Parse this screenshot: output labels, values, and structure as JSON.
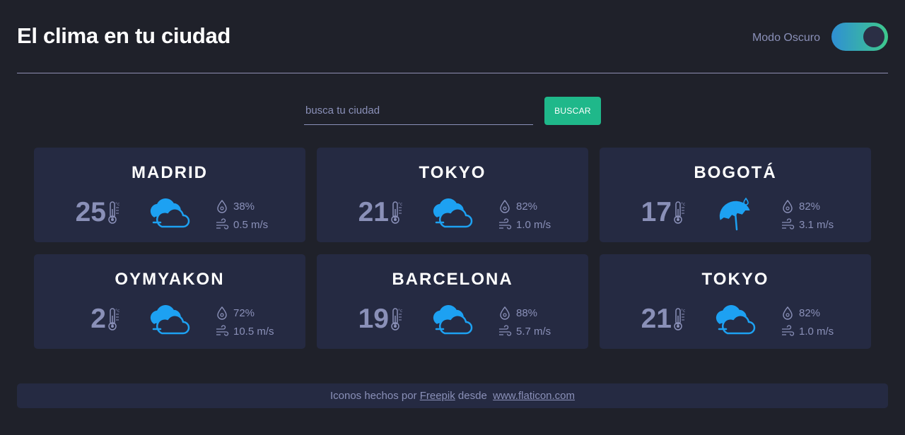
{
  "header": {
    "title": "El clima en tu ciudad",
    "dark_mode_label": "Modo Oscuro",
    "dark_mode_on": true
  },
  "search": {
    "placeholder": "busca tu ciudad",
    "value": "",
    "button_label": "BUSCAR"
  },
  "cards": [
    {
      "city": "MADRID",
      "temp": "25",
      "icon": "cloudy-icon",
      "humidity": "38%",
      "wind": "0.5 m/s"
    },
    {
      "city": "TOKYO",
      "temp": "21",
      "icon": "cloudy-icon",
      "humidity": "82%",
      "wind": "1.0 m/s"
    },
    {
      "city": "BOGOTÁ",
      "temp": "17",
      "icon": "umbrella-rain-icon",
      "humidity": "82%",
      "wind": "3.1 m/s"
    },
    {
      "city": "OYMYAKON",
      "temp": "2",
      "icon": "cloudy-icon",
      "humidity": "72%",
      "wind": "10.5 m/s"
    },
    {
      "city": "BARCELONA",
      "temp": "19",
      "icon": "cloudy-icon",
      "humidity": "88%",
      "wind": "5.7 m/s"
    },
    {
      "city": "TOKYO",
      "temp": "21",
      "icon": "cloudy-icon",
      "humidity": "82%",
      "wind": "1.0 m/s"
    }
  ],
  "footer": {
    "prefix": "Iconos hechos por",
    "author_link": "Freepik",
    "middle": "desde",
    "site_link": "www.flaticon.com"
  },
  "colors": {
    "background": "#1f212a",
    "card": "#252a42",
    "accent": "#1fb88a",
    "icon_blue": "#1da1f2",
    "muted": "#8a90b8"
  }
}
